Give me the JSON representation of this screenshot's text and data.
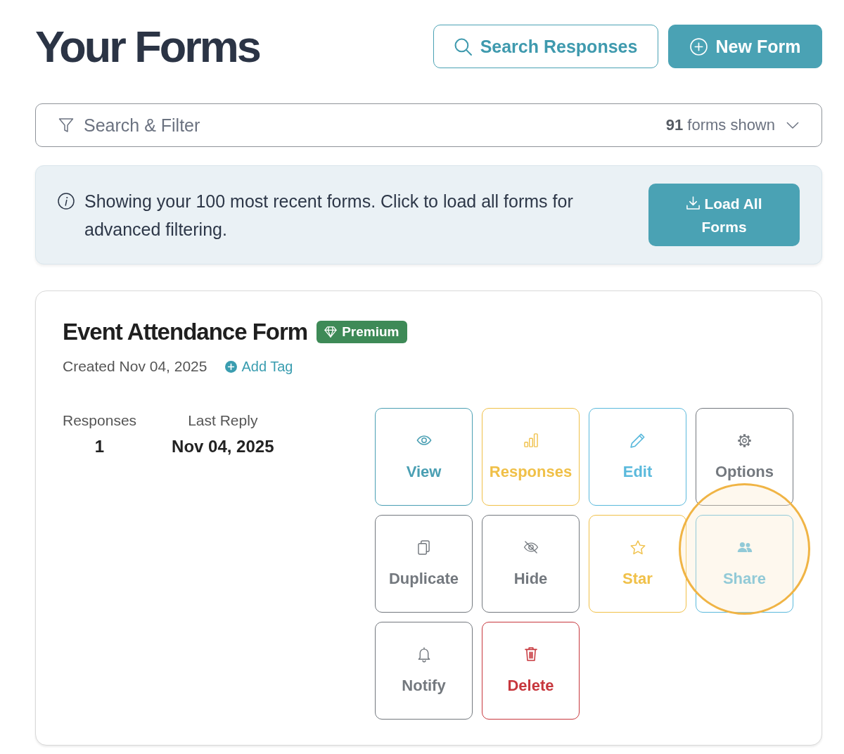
{
  "header": {
    "title": "Your Forms",
    "buttons": [
      {
        "kind": "outline",
        "label": "Search Responses"
      },
      {
        "kind": "primary",
        "label": "New Form"
      }
    ]
  },
  "filter": {
    "label": "Search & Filter",
    "count": "**91** forms shown",
    "expanded": false
  },
  "notice": {
    "text": "Showing your 100 most recent forms. Click to load all forms for advanced filtering.",
    "button": "Load All Forms"
  },
  "forms": [
    {
      "title": "Event Attendance Form",
      "badge": "Premium",
      "created": "Created Nov 04, 2025",
      "add_tag": "Add Tag",
      "stats": [
        {
          "label": "Responses",
          "value": "1"
        },
        {
          "label": "Last Reply",
          "value": "Nov 04, 2025"
        }
      ],
      "actions": [
        {
          "kind": "view",
          "label": "View",
          "color": "#4a9fb3",
          "highlighted": false
        },
        {
          "kind": "responses",
          "label": "Responses",
          "color": "#f0c048",
          "highlighted": false
        },
        {
          "kind": "edit",
          "label": "Edit",
          "color": "#5ab9dc",
          "highlighted": false
        },
        {
          "kind": "options",
          "label": "Options",
          "color": "#73787e",
          "highlighted": false
        },
        {
          "kind": "duplicate",
          "label": "Duplicate",
          "color": "#73787e",
          "highlighted": false
        },
        {
          "kind": "hide",
          "label": "Hide",
          "color": "#73787e",
          "highlighted": false
        },
        {
          "kind": "star",
          "label": "Star",
          "color": "#f0c048",
          "highlighted": false
        },
        {
          "kind": "share",
          "label": "Share",
          "color": "#5ab9dc",
          "highlighted": true
        },
        {
          "kind": "notify",
          "label": "Notify",
          "color": "#73787e",
          "highlighted": false
        },
        {
          "kind": "delete",
          "label": "Delete",
          "color": "#c7373d",
          "highlighted": false
        }
      ]
    }
  ]
}
